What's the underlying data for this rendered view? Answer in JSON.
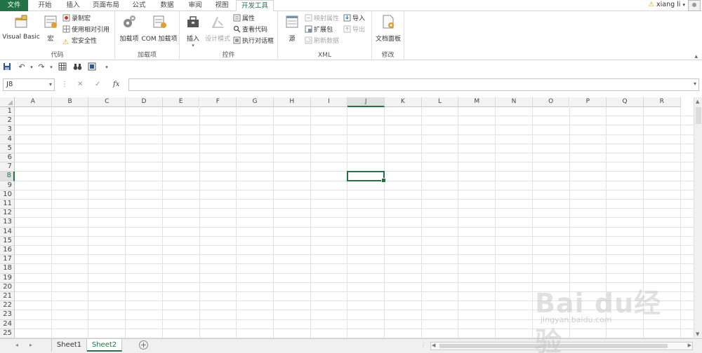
{
  "tabs": [
    {
      "label": "文件"
    },
    {
      "label": "开始"
    },
    {
      "label": "插入"
    },
    {
      "label": "页面布局"
    },
    {
      "label": "公式"
    },
    {
      "label": "数据"
    },
    {
      "label": "审阅"
    },
    {
      "label": "视图"
    },
    {
      "label": "开发工具"
    }
  ],
  "user": {
    "name": "xiang li",
    "warn_icon": "warning-icon"
  },
  "ribbon": {
    "code": {
      "label": "代码",
      "visual_basic": "Visual Basic",
      "macros": "宏",
      "record_macro": "录制宏",
      "relative_ref": "使用相对引用",
      "macro_security": "宏安全性"
    },
    "addins": {
      "label": "加载项",
      "addins_btn": "加载项",
      "com_addins": "COM 加载项"
    },
    "controls": {
      "label": "控件",
      "insert": "插入",
      "design_mode": "设计模式",
      "properties": "属性",
      "view_code": "查看代码",
      "run_dialog": "执行对话框"
    },
    "xml": {
      "label": "XML",
      "source": "源",
      "map_props": "映射属性",
      "expansion_packs": "扩展包",
      "refresh_data": "刷新数据",
      "import": "导入",
      "export": "导出"
    },
    "modify": {
      "label": "修改",
      "doc_panel": "文档面板"
    }
  },
  "name_box": "J8",
  "fx_label": "fx",
  "columns": [
    "A",
    "B",
    "C",
    "D",
    "E",
    "F",
    "G",
    "H",
    "I",
    "J",
    "K",
    "L",
    "M",
    "N",
    "O",
    "P",
    "Q",
    "R"
  ],
  "rows": [
    "1",
    "2",
    "3",
    "4",
    "5",
    "6",
    "7",
    "8",
    "9",
    "10",
    "11",
    "12",
    "13",
    "14",
    "15",
    "16",
    "17",
    "18",
    "19",
    "20",
    "21",
    "22",
    "23",
    "24",
    "25"
  ],
  "selected": {
    "col": "J",
    "row": "8"
  },
  "sheets": [
    {
      "label": "Sheet1"
    },
    {
      "label": "Sheet2"
    }
  ],
  "active_sheet": "Sheet2",
  "watermark": {
    "brand": "Bai du经验",
    "url": "jingyan.baidu.com"
  },
  "colors": {
    "accent": "#217346"
  }
}
